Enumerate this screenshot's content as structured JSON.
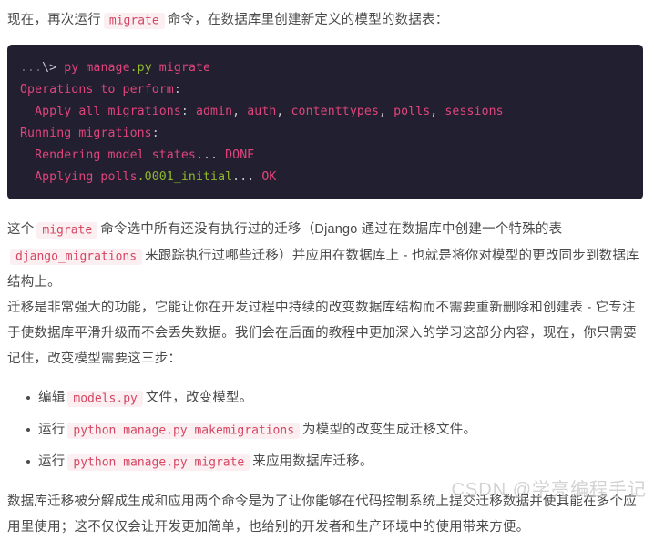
{
  "theme": {
    "page_background": "#ffffff",
    "body_text_color": "#4b4b4b",
    "inline_code_color": "#d64561",
    "inline_code_background": "#fbeff2",
    "codeblock_background": "#221f30",
    "codeblock_text_color": "#e0457b",
    "codeblock_accent_green": "#8fbb2c",
    "codeblock_dim_color": "#6f6a86",
    "watermark_color": "#cccccc"
  },
  "intro_paragraph": {
    "part1": "现在，再次运行",
    "code": "migrate",
    "part2": "命令，在数据库里创建新定义的模型的数据表："
  },
  "codeblock": {
    "lines": [
      {
        "segments": [
          {
            "text": "...",
            "style": "dim"
          },
          {
            "text": "\\>",
            "style": "white"
          },
          {
            "text": " py manage",
            "style": "pink"
          },
          {
            "text": ".py",
            "style": "green"
          },
          {
            "text": " migrate",
            "style": "pink"
          }
        ]
      },
      {
        "segments": [
          {
            "text": "Operations to perform",
            "style": "pink"
          },
          {
            "text": ":",
            "style": "white"
          }
        ]
      },
      {
        "segments": [
          {
            "text": "  Apply all migrations",
            "style": "pink"
          },
          {
            "text": ":",
            "style": "white"
          },
          {
            "text": " admin",
            "style": "pink"
          },
          {
            "text": ",",
            "style": "white"
          },
          {
            "text": " auth",
            "style": "pink"
          },
          {
            "text": ",",
            "style": "white"
          },
          {
            "text": " contenttypes",
            "style": "pink"
          },
          {
            "text": ",",
            "style": "white"
          },
          {
            "text": " polls",
            "style": "pink"
          },
          {
            "text": ",",
            "style": "white"
          },
          {
            "text": " sessions",
            "style": "pink"
          }
        ]
      },
      {
        "segments": [
          {
            "text": "Running migrations",
            "style": "pink"
          },
          {
            "text": ":",
            "style": "white"
          }
        ]
      },
      {
        "segments": [
          {
            "text": "  Rendering model states",
            "style": "pink"
          },
          {
            "text": "...",
            "style": "white"
          },
          {
            "text": " DONE",
            "style": "pink"
          }
        ]
      },
      {
        "segments": [
          {
            "text": "  Applying polls",
            "style": "pink"
          },
          {
            "text": ".0001_initial",
            "style": "green"
          },
          {
            "text": "...",
            "style": "white"
          },
          {
            "text": " OK",
            "style": "pink"
          }
        ]
      }
    ]
  },
  "explain_paragraph": {
    "part1": "这个",
    "code1": "migrate",
    "part2": "命令选中所有还没有执行过的迁移（Django 通过在数据库中创建一个特殊的表",
    "code2": "django_migrations",
    "part3": "来跟踪执行过哪些迁移）并应用在数据库上 - 也就是将你对模型的更改同步到数据库结构上。"
  },
  "migration_paragraph": {
    "text": "迁移是非常强大的功能，它能让你在开发过程中持续的改变数据库结构而不需要重新删除和创建表 - 它专注于使数据库平滑升级而不会丢失数据。我们会在后面的教程中更加深入的学习这部分内容，现在，你只需要记住，改变模型需要这三步："
  },
  "steps": [
    {
      "prefix": "编辑",
      "code": "models.py",
      "suffix": "文件，改变模型。"
    },
    {
      "prefix": "运行",
      "code": "python manage.py makemigrations",
      "suffix": "为模型的改变生成迁移文件。"
    },
    {
      "prefix": "运行",
      "code": "python manage.py migrate",
      "suffix": "来应用数据库迁移。"
    }
  ],
  "closing_paragraph": {
    "text": "数据库迁移被分解成生成和应用两个命令是为了让你能够在代码控制系统上提交迁移数据并使其能在多个应用里使用；这不仅仅会让开发更加简单，也给别的开发者和生产环境中的使用带来方便。"
  },
  "watermark": {
    "text": "CSDN @学亮编程手记"
  }
}
